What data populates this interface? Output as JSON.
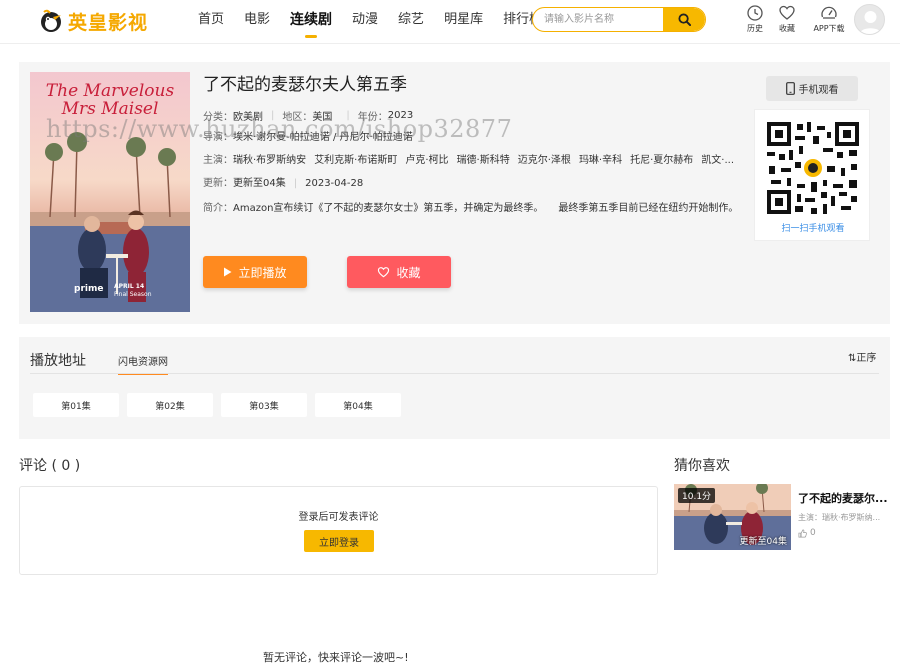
{
  "header": {
    "logo_text": "英皇影视",
    "nav": [
      "首页",
      "电影",
      "连续剧",
      "动漫",
      "综艺",
      "明星库",
      "排行榜"
    ],
    "active_nav": 2,
    "search_placeholder": "请输入影片名称",
    "tools": {
      "history": "历史",
      "favorites": "收藏",
      "app": "APP下载"
    }
  },
  "detail": {
    "title": "了不起的麦瑟尔夫人第五季",
    "category_label": "分类：",
    "category": "欧美剧",
    "region_label": "地区：",
    "region": "美国",
    "year_label": "年份：",
    "year": "2023",
    "director_label": "导演：",
    "director": "埃米·谢尔曼-帕拉迪诺 / 丹尼尔·帕拉迪诺",
    "cast_label": "主演：",
    "cast": [
      "瑞秋·布罗斯纳安",
      "艾利克斯·布诺斯町",
      "卢克·柯比",
      "瑞德·斯科特",
      "迈克尔·泽根",
      "玛琳·辛科",
      "托尼·夏尔赫布",
      "凯文·..."
    ],
    "update_label": "更新：",
    "update": "更新至04集",
    "update_date": "2023-04-28",
    "intro_label": "简介：",
    "intro": "Amazon宣布续订《了不起的麦瑟尔女士》第五季，并确定为最终季。　　最终季第五季目前已经在纽约开始制作。",
    "play_button": "立即播放",
    "fav_button": "收藏",
    "mobile_watch": "手机观看",
    "qr_caption": "扫一扫手机观看",
    "poster_title": "The Marvelous Mrs Maisel",
    "poster_brand": "prime",
    "poster_date": "APRIL 14",
    "poster_sub": "Final Season"
  },
  "playlist": {
    "title": "播放地址",
    "source_tab": "闪电资源网",
    "order": "⇅正序",
    "episodes": [
      "第01集",
      "第02集",
      "第03集",
      "第04集"
    ]
  },
  "comments": {
    "title": "评论 ( 0 )",
    "login_hint": "登录后可发表评论",
    "login_button": "立即登录",
    "empty_text": "暂无评论，快来评论一波吧~!"
  },
  "guess": {
    "title": "猜你喜欢",
    "item": {
      "name": "了不起的麦瑟尔...",
      "score": "10.1分",
      "update": "更新至04集",
      "cast": "主演：瑞秋·布罗斯纳...",
      "likes": "0"
    }
  },
  "watermark": "https://www.huzhan.com/ishop32877",
  "colors": {
    "accent": "#f7b800",
    "play": "#ff8a1f",
    "fav": "#ff5a5f",
    "link": "#3a8ee6"
  }
}
